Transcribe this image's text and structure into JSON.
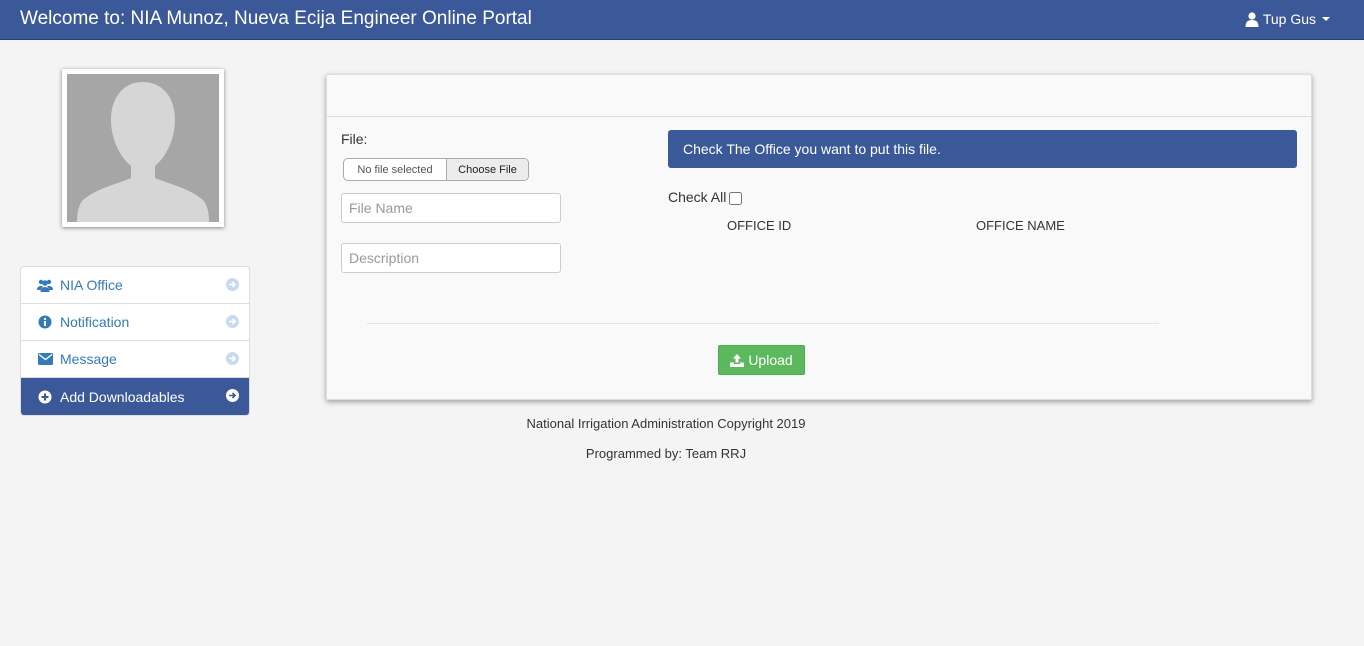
{
  "header": {
    "title": "Welcome to: NIA Munoz, Nueva Ecija Engineer Online Portal",
    "user_name": "Tup Gus"
  },
  "sidebar": {
    "items": [
      {
        "label": "NIA Office",
        "icon": "users-icon",
        "active": false
      },
      {
        "label": "Notification",
        "icon": "info-icon",
        "active": false
      },
      {
        "label": "Message",
        "icon": "envelope-icon",
        "active": false
      },
      {
        "label": "Add Downloadables",
        "icon": "plus-circle-icon",
        "active": true
      }
    ]
  },
  "form": {
    "file_label": "File:",
    "file_status": "No file selected",
    "choose_label": "Choose File",
    "file_name_placeholder": "File Name",
    "description_placeholder": "Description",
    "upload_label": "Upload"
  },
  "offices": {
    "banner": "Check The Office you want to put this file.",
    "check_all_label": "Check All",
    "columns": [
      "OFFICE ID",
      "OFFICE NAME"
    ]
  },
  "footer": {
    "copyright": "National Irrigation Administration Copyright 2019",
    "programmed_by": "Programmed by: Team RRJ"
  },
  "colors": {
    "brand": "#3b5998",
    "success": "#5cb85c",
    "link": "#337ab7"
  }
}
